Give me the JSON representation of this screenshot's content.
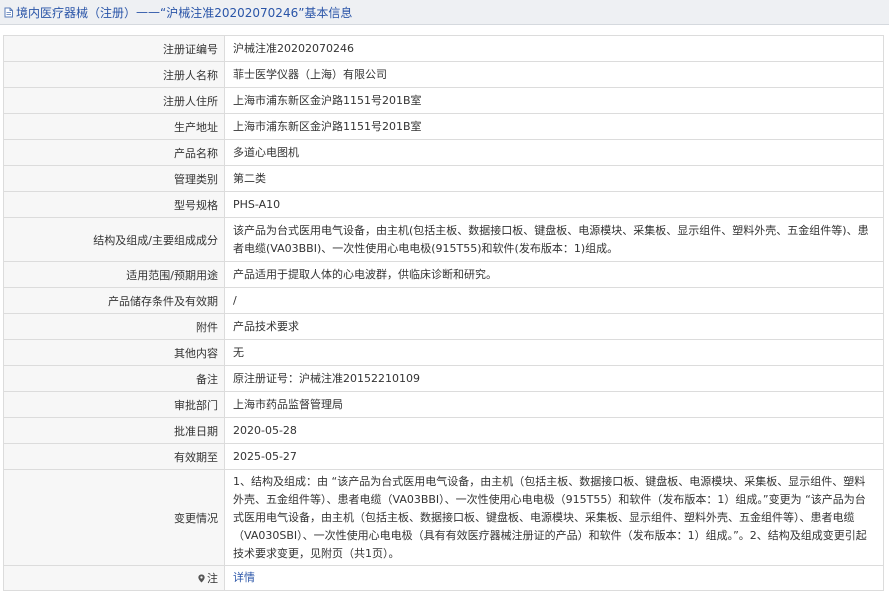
{
  "header": {
    "prefix": "境内医疗器械（注册）",
    "separator": " —— ",
    "title": "“沪械注准20202070246”基本信息"
  },
  "rows": [
    {
      "label": "注册证编号",
      "value": "沪械注准20202070246"
    },
    {
      "label": "注册人名称",
      "value": "菲士医学仪器（上海）有限公司"
    },
    {
      "label": "注册人住所",
      "value": "上海市浦东新区金沪路1151号201B室"
    },
    {
      "label": "生产地址",
      "value": "上海市浦东新区金沪路1151号201B室"
    },
    {
      "label": "产品名称",
      "value": "多道心电图机"
    },
    {
      "label": "管理类别",
      "value": "第二类"
    },
    {
      "label": "型号规格",
      "value": "PHS-A10"
    },
    {
      "label": "结构及组成/主要组成成分",
      "value": "该产品为台式医用电气设备，由主机(包括主板、数据接口板、键盘板、电源模块、采集板、显示组件、塑料外壳、五金组件等)、患者电缆(VA03BBI)、一次性使用心电电极(915T55)和软件(发布版本：1)组成。"
    },
    {
      "label": "适用范围/预期用途",
      "value": "产品适用于提取人体的心电波群，供临床诊断和研究。"
    },
    {
      "label": "产品储存条件及有效期",
      "value": "/"
    },
    {
      "label": "附件",
      "value": "产品技术要求"
    },
    {
      "label": "其他内容",
      "value": "无"
    },
    {
      "label": "备注",
      "value": "原注册证号：沪械注准20152210109"
    },
    {
      "label": "审批部门",
      "value": "上海市药品监督管理局"
    },
    {
      "label": "批准日期",
      "value": "2020-05-28"
    },
    {
      "label": "有效期至",
      "value": "2025-05-27"
    },
    {
      "label": "变更情况",
      "value": "1、结构及组成：由 “该产品为台式医用电气设备，由主机（包括主板、数据接口板、键盘板、电源模块、采集板、显示组件、塑料外壳、五金组件等）、患者电缆（VA03BBI）、一次性使用心电电极（915T55）和软件（发布版本：1）组成。”变更为 “该产品为台式医用电气设备，由主机（包括主板、数据接口板、键盘板、电源模块、采集板、显示组件、塑料外壳、五金组件等）、患者电缆（VA030SBI）、一次性使用心电电极（具有有效医疗器械注册证的产品）和软件（发布版本：1）组成。”。2、结构及组成变更引起技术要求变更，见附页（共1页）。"
    }
  ],
  "note": {
    "label": "注",
    "link": "详情"
  }
}
